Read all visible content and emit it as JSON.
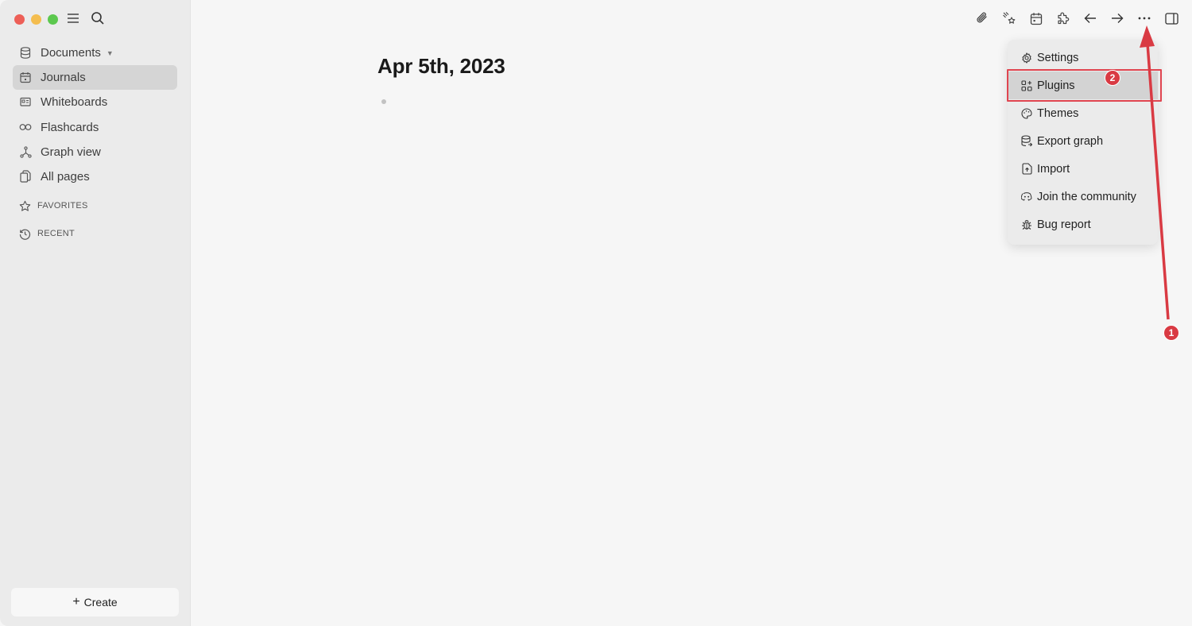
{
  "sidebar": {
    "traffic_lights": {
      "close": "#ed5f57",
      "minimize": "#f4bd4f",
      "maximize": "#5cc84e"
    },
    "top_icons": [
      "menu-icon",
      "search-icon"
    ],
    "items": [
      {
        "label": "Documents",
        "icon": "database-icon",
        "has_dropdown": true
      },
      {
        "label": "Journals",
        "icon": "calendar-icon",
        "active": true
      },
      {
        "label": "Whiteboards",
        "icon": "whiteboard-icon"
      },
      {
        "label": "Flashcards",
        "icon": "infinity-icon"
      },
      {
        "label": "Graph view",
        "icon": "graph-icon"
      },
      {
        "label": "All pages",
        "icon": "pages-icon"
      }
    ],
    "sections": [
      {
        "label": "FAVORITES",
        "icon": "star-icon"
      },
      {
        "label": "RECENT",
        "icon": "history-icon"
      }
    ],
    "create_label": "Create"
  },
  "toolbar": {
    "icons": [
      "attachment-icon",
      "sparkles-icon",
      "calendar-icon",
      "puzzle-icon",
      "arrow-left-icon",
      "arrow-right-icon",
      "more-icon",
      "sidebar-toggle-icon"
    ]
  },
  "main": {
    "page_title": "Apr 5th, 2023"
  },
  "menu": {
    "items": [
      {
        "label": "Settings",
        "icon": "gear-icon"
      },
      {
        "label": "Plugins",
        "icon": "plugins-icon",
        "highlighted": true
      },
      {
        "label": "Themes",
        "icon": "palette-icon"
      },
      {
        "label": "Export graph",
        "icon": "export-icon"
      },
      {
        "label": "Import",
        "icon": "import-icon"
      },
      {
        "label": "Join the community",
        "icon": "discord-icon"
      },
      {
        "label": "Bug report",
        "icon": "bug-icon"
      }
    ]
  },
  "annotations": {
    "color": "#d93a43",
    "badges": [
      "1",
      "2"
    ]
  }
}
